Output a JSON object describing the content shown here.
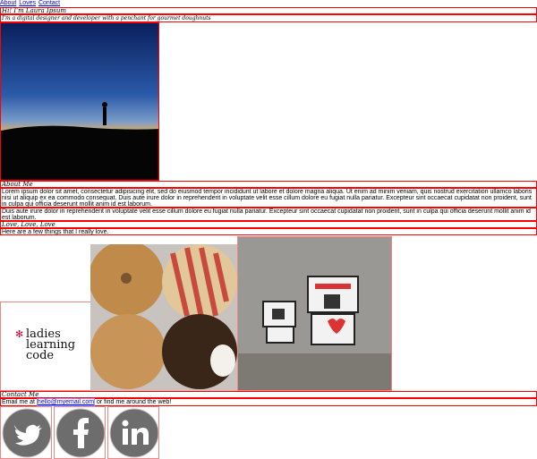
{
  "nav": {
    "items": [
      "About",
      "Loves",
      "Contact"
    ]
  },
  "intro": {
    "heading": "Hi! I'm Laura Ipsum",
    "tagline": "I'm a digital designer and developer with a penchant for gourmet doughnuts"
  },
  "about": {
    "title": "About Me",
    "paragraph1": "Lorem ipsum dolor sit amet, consectetur adipisicing elit, sed do eiusmod tempor incididunt ut labore et dolore magna aliqua. Ut enim ad minim veniam, quis nostrud exercitation ullamco laboris nisi ut aliquip ex ea commodo consequat. Duis aute irure dolor in reprehenderit in voluptate velit esse cillum dolore eu fugiat nulla pariatur. Excepteur sint occaecat cupidatat non proident, sunt in culpa qui officia deserunt mollit anim id est laborum.",
    "paragraph2": "Duis aute irure dolor in reprehenderit in voluptate velit esse cillum dolore eu fugiat nulla pariatur. Excepteur sint occaecat cupidatat non proident, sunt in culpa qui officia deserunt mollit anim id est laborum."
  },
  "loves": {
    "title": "Love, Love, Love",
    "intro": "Here are a few things that I really love.",
    "llc_logo": [
      "ladies",
      "learning",
      "code"
    ]
  },
  "contact": {
    "title": "Contact Me",
    "prefix": "Email me at",
    "email": "hello@myemail.com",
    "suffix": "or find me around the web!"
  },
  "social": [
    {
      "icon": "twitter-icon"
    },
    {
      "icon": "facebook-icon"
    },
    {
      "icon": "linkedin-icon"
    }
  ],
  "colors": {
    "outline": "#ff0000",
    "icon_gray": "#6d6d6d",
    "link": "#0000ee"
  }
}
